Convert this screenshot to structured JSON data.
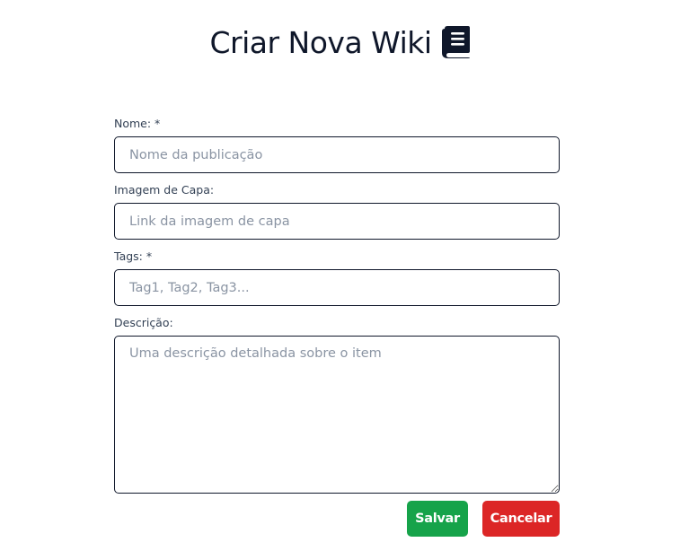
{
  "header": {
    "title": "Criar Nova Wiki",
    "icon": "book-icon"
  },
  "form": {
    "name": {
      "label": "Nome: *",
      "placeholder": "Nome da publicação",
      "value": ""
    },
    "cover": {
      "label": "Imagem de Capa:",
      "placeholder": "Link da imagem de capa",
      "value": ""
    },
    "tags": {
      "label": "Tags: *",
      "placeholder": "Tag1, Tag2, Tag3...",
      "value": ""
    },
    "description": {
      "label": "Descrição:",
      "placeholder": "Uma descrição detalhada sobre o item",
      "value": ""
    }
  },
  "actions": {
    "save_label": "Salvar",
    "cancel_label": "Cancelar"
  },
  "colors": {
    "save": "#16a34a",
    "cancel": "#dc2626",
    "text": "#0f172a",
    "border": "#0f172a",
    "placeholder": "#8a94a3"
  }
}
